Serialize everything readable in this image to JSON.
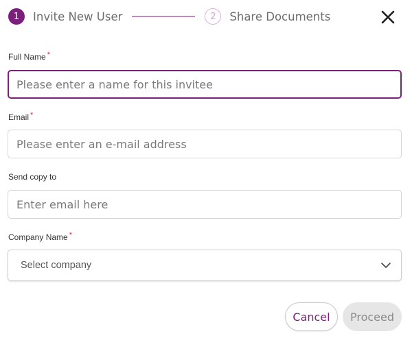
{
  "stepper": {
    "steps": [
      {
        "number": "1",
        "label": "Invite New User",
        "state": "active"
      },
      {
        "number": "2",
        "label": "Share Documents",
        "state": "inactive"
      }
    ]
  },
  "close": {
    "icon": "close-icon"
  },
  "form": {
    "full_name": {
      "label": "Full Name",
      "required_mark": "*",
      "placeholder": "Please enter a name for this invitee"
    },
    "email": {
      "label": "Email",
      "required_mark": "*",
      "placeholder": "Please enter an e-mail address"
    },
    "send_copy": {
      "label": "Send copy to",
      "placeholder": "Enter email here"
    },
    "company": {
      "label": "Company Name",
      "required_mark": "*",
      "selected": "Select company",
      "icon": "chevron-down-icon"
    }
  },
  "actions": {
    "cancel_label": "Cancel",
    "proceed_label": "Proceed"
  },
  "colors": {
    "accent": "#7a1f7a",
    "required": "#d22b2b",
    "disabled_bg": "#e6e6e6"
  }
}
